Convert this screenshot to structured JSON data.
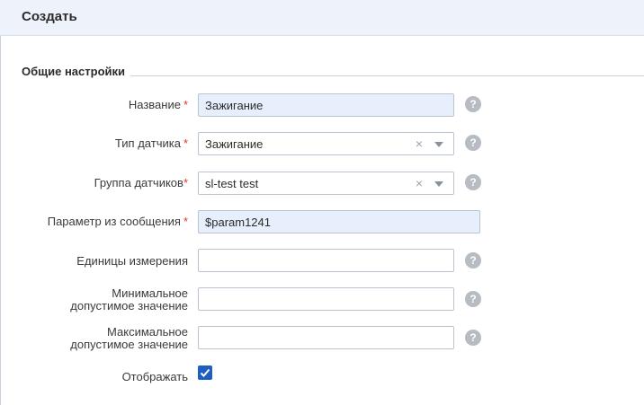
{
  "header": {
    "title": "Создать"
  },
  "section": {
    "title": "Общие настройки"
  },
  "fields": {
    "name": {
      "label": "Название",
      "required": "*",
      "value": "Зажигание",
      "help": "?"
    },
    "sensor_type": {
      "label": "Тип датчика",
      "required": "*",
      "value": "Зажигание",
      "clear": "×",
      "help": "?"
    },
    "sensor_group": {
      "label": "Группа датчиков",
      "required": "*",
      "value": "sl-test test",
      "clear": "×",
      "help": "?"
    },
    "message_param": {
      "label": "Параметр из сообщения",
      "required": "*",
      "value": "$param1241"
    },
    "units": {
      "label": "Единицы измерения",
      "value": "",
      "help": "?"
    },
    "min_value": {
      "label_line1": "Минимальное",
      "label_line2": "допустимое значение",
      "value": "",
      "help": "?"
    },
    "max_value": {
      "label_line1": "Максимальное",
      "label_line2": "допустимое значение",
      "value": "",
      "help": "?"
    },
    "display": {
      "label": "Отображать",
      "checked": true
    }
  },
  "colors": {
    "accent": "#1f5fbf",
    "required": "#e0352b",
    "filled_input_bg": "#e7effc",
    "header_bg": "#eef3fb"
  },
  "icons": {
    "help": "question-circle-icon",
    "clear": "clear-x-icon",
    "dropdown": "chevron-down-icon",
    "check": "check-icon"
  }
}
